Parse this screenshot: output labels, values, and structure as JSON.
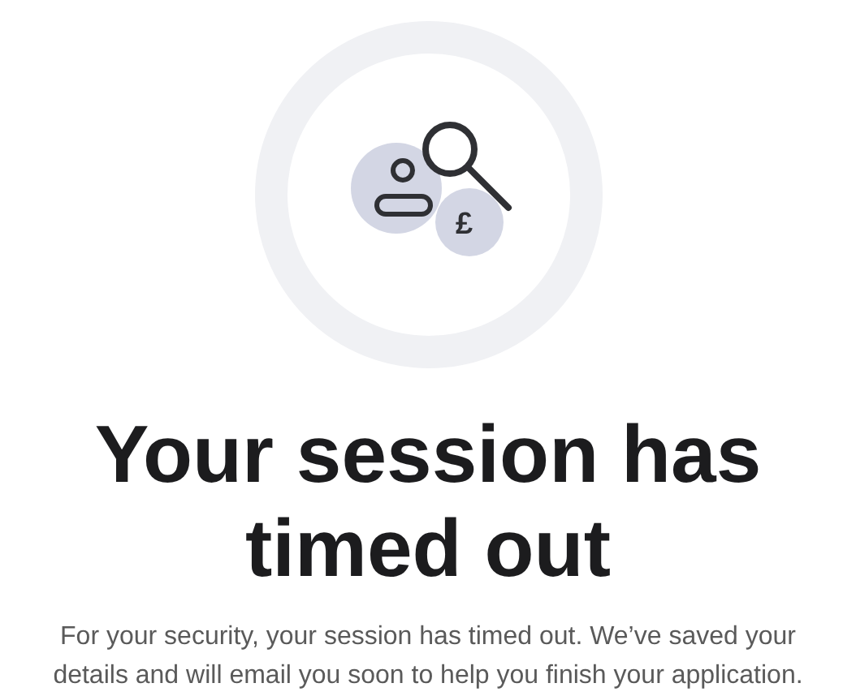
{
  "icon_symbol": "£",
  "heading": "Your session has timed out",
  "message": "For your security, your session has timed out. We’ve saved your details and will email you soon to help you finish your application."
}
